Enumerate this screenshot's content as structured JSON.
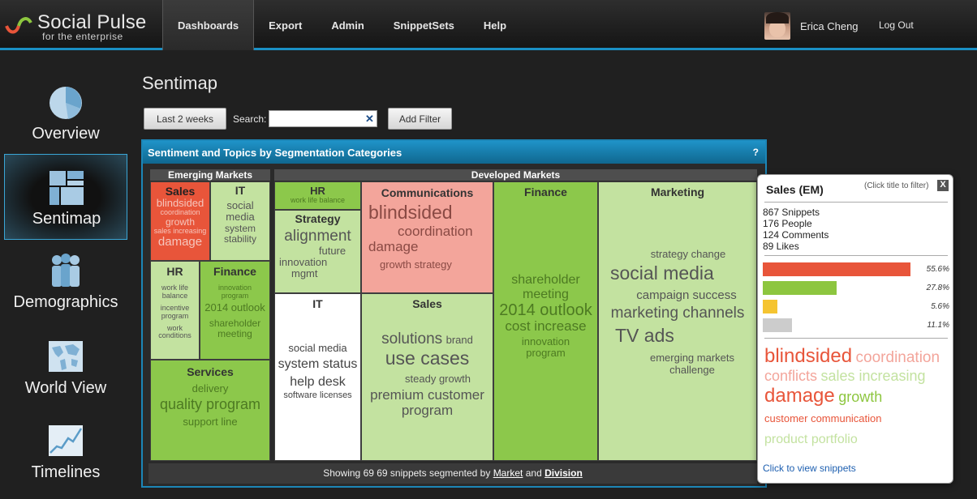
{
  "app": {
    "name": "Social Pulse",
    "tagline": "for the enterprise"
  },
  "nav": [
    "Dashboards",
    "Export",
    "Admin",
    "SnippetSets",
    "Help"
  ],
  "user": {
    "name": "Erica Cheng",
    "logout": "Log Out"
  },
  "sidebar": [
    {
      "label": "Overview",
      "icon": "pie-chart-icon"
    },
    {
      "label": "Sentimap",
      "icon": "treemap-icon",
      "active": true
    },
    {
      "label": "Demographics",
      "icon": "people-icon"
    },
    {
      "label": "World View",
      "icon": "globe-icon"
    },
    {
      "label": "Timelines",
      "icon": "line-chart-icon"
    }
  ],
  "page": {
    "title": "Sentimap"
  },
  "toolbar": {
    "date_range": "Last 2 weeks",
    "search_label": "Search:",
    "search_value": "",
    "add_filter": "Add Filter"
  },
  "panel": {
    "title": "Sentiment and Topics by Segmentation Categories",
    "help": "?",
    "groups": [
      "Emerging Markets",
      "Developed Markets"
    ],
    "footer": {
      "prefix": "Showing 69 69 snippets segmented by",
      "market": "Market",
      "and": "and",
      "division": "Division"
    }
  },
  "colors": {
    "negative": "#e8553a",
    "positive": "#8dc63f",
    "neutral": "#f5c431",
    "mixed": "#cccccc",
    "pink": "#f3a59b",
    "lightgreen": "#c3e2a0",
    "darkgreen": "#8cc84b"
  },
  "cells": [
    {
      "id": "em-sales",
      "title": "Sales",
      "words": [
        "blindsided",
        "coordination",
        "growth",
        "sales increasing",
        "damage"
      ]
    },
    {
      "id": "em-it",
      "title": "IT",
      "words": [
        "social",
        "media",
        "system",
        "stability"
      ]
    },
    {
      "id": "em-hr",
      "title": "HR",
      "words": [
        "work life",
        "balance",
        "incentive",
        "program",
        "work",
        "conditions"
      ]
    },
    {
      "id": "em-finance",
      "title": "Finance",
      "words": [
        "innovation",
        "program",
        "2014 outlook",
        "shareholder",
        "meeting"
      ]
    },
    {
      "id": "em-services",
      "title": "Services",
      "words": [
        "delivery",
        "quality program",
        "support line"
      ]
    },
    {
      "id": "dm-hr",
      "title": "HR",
      "words": [
        "work life balance"
      ]
    },
    {
      "id": "dm-strategy",
      "title": "Strategy",
      "words": [
        "alignment",
        "future",
        "innovation",
        "mgmt"
      ]
    },
    {
      "id": "dm-communications",
      "title": "Communications",
      "words": [
        "blindsided",
        "coordination",
        "damage",
        "growth strategy"
      ]
    },
    {
      "id": "dm-finance",
      "title": "Finance",
      "words": [
        "shareholder",
        "meeting",
        "2014 outlook",
        "cost increase",
        "innovation",
        "program"
      ]
    },
    {
      "id": "dm-marketing",
      "title": "Marketing",
      "words": [
        "strategy change",
        "social media",
        "campaign success",
        "marketing channels",
        "TV ads",
        "emerging markets",
        "challenge"
      ]
    },
    {
      "id": "dm-it",
      "title": "IT",
      "words": [
        "social media",
        "system status",
        "help desk",
        "software licenses"
      ]
    },
    {
      "id": "dm-sales",
      "title": "Sales",
      "words": [
        "solutions",
        "brand",
        "use cases",
        "steady growth",
        "premium customer",
        "program"
      ]
    }
  ],
  "popup": {
    "title": "Sales (EM)",
    "hint": "(Click title to filter)",
    "close": "X",
    "stats": [
      "867 Snippets",
      "176 People",
      "124 Comments",
      "89 Likes"
    ],
    "bars": [
      {
        "label": "55.6%",
        "value": 55.6,
        "color": "#e8553a"
      },
      {
        "label": "27.8%",
        "value": 27.8,
        "color": "#8dc63f"
      },
      {
        "label": "5.6%",
        "value": 5.6,
        "color": "#f5c431"
      },
      {
        "label": "11.1%",
        "value": 11.1,
        "color": "#cccccc"
      }
    ],
    "words": [
      "blindsided",
      "coordination",
      "conflicts",
      "sales increasing",
      "damage",
      "growth",
      "customer communication",
      "product portfolio"
    ],
    "link": "Click to view snippets"
  }
}
